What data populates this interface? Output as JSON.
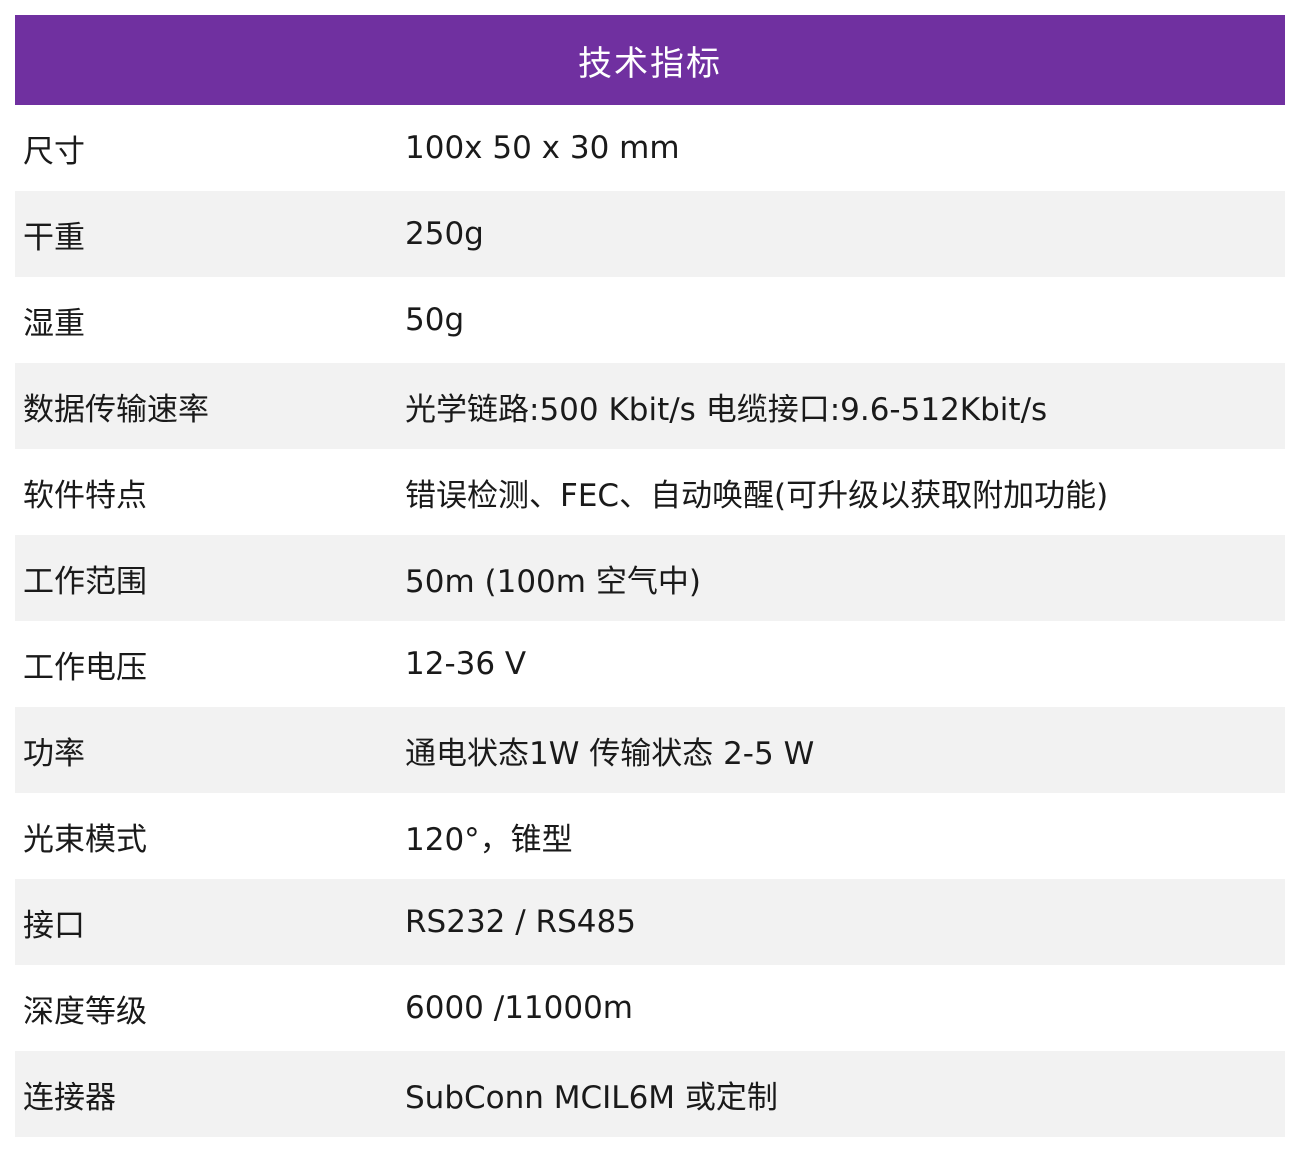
{
  "table": {
    "title": "技术指标",
    "rows": [
      {
        "label": "尺寸",
        "value": "100x 50 x 30 mm"
      },
      {
        "label": "干重",
        "value": "250g"
      },
      {
        "label": "湿重",
        "value": "50g"
      },
      {
        "label": "数据传输速率",
        "value": "光学链路:500 Kbit/s  电缆接口:9.6-512Kbit/s"
      },
      {
        "label": "软件特点",
        "value": "错误检测、FEC、自动唤醒(可升级以获取附加功能)"
      },
      {
        "label": "工作范围",
        "value": "50m (100m 空气中)"
      },
      {
        "label": "工作电压",
        "value": "12-36 V"
      },
      {
        "label": "功率",
        "value": "通电状态1W  传输状态 2-5 W"
      },
      {
        "label": "光束模式",
        "value": "120°，锥型"
      },
      {
        "label": "接口",
        "value": "RS232 / RS485"
      },
      {
        "label": "深度等级",
        "value": "6000 /11000m"
      },
      {
        "label": "连接器",
        "value": "SubConn MCIL6M 或定制"
      }
    ]
  },
  "colors": {
    "header_bg": "#7030a0",
    "header_text": "#ffffff",
    "stripe": "#f2f2f2"
  }
}
